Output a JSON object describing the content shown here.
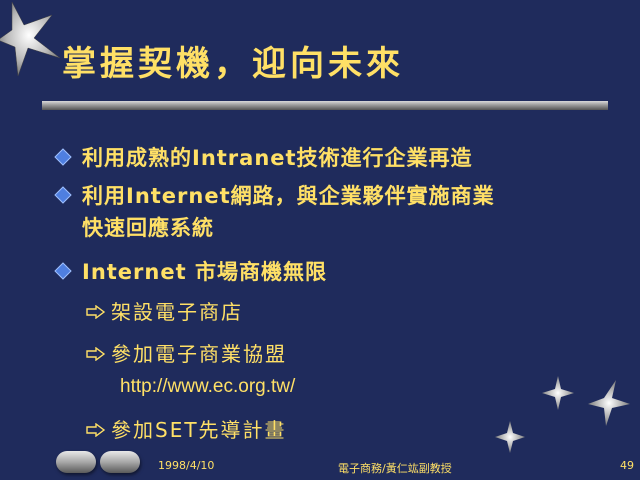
{
  "slide": {
    "title": "掌握契機，迎向未來",
    "bullets": [
      {
        "icon": "diamond-bullet-icon",
        "lines": [
          "利用成熟的Intranet技術進行企業再造"
        ]
      },
      {
        "icon": "diamond-bullet-icon",
        "lines": [
          "利用Internet網路，與企業夥伴實施商業",
          "快速回應系統"
        ]
      },
      {
        "icon": "diamond-bullet-icon",
        "lines": [
          "Internet 市場商機無限"
        ]
      }
    ],
    "sub_bullets": [
      {
        "icon": "arrow-right-icon",
        "text": "架設電子商店"
      },
      {
        "icon": "arrow-right-icon",
        "text": "參加電子商業協盟"
      },
      {
        "icon": "arrow-right-icon",
        "text": "參加SET先導計畫"
      }
    ],
    "url": "http://www.ec.org.tw/"
  },
  "footer": {
    "date": "1998/4/10",
    "center": "電子商務/黃仁竑副教授",
    "page_number": "49",
    "nav_buttons": [
      "previous-slide-button",
      "next-slide-button"
    ]
  },
  "colors": {
    "background": "#1f2b5c",
    "text": "#ffe066",
    "bullet": "#4f7fe0"
  }
}
